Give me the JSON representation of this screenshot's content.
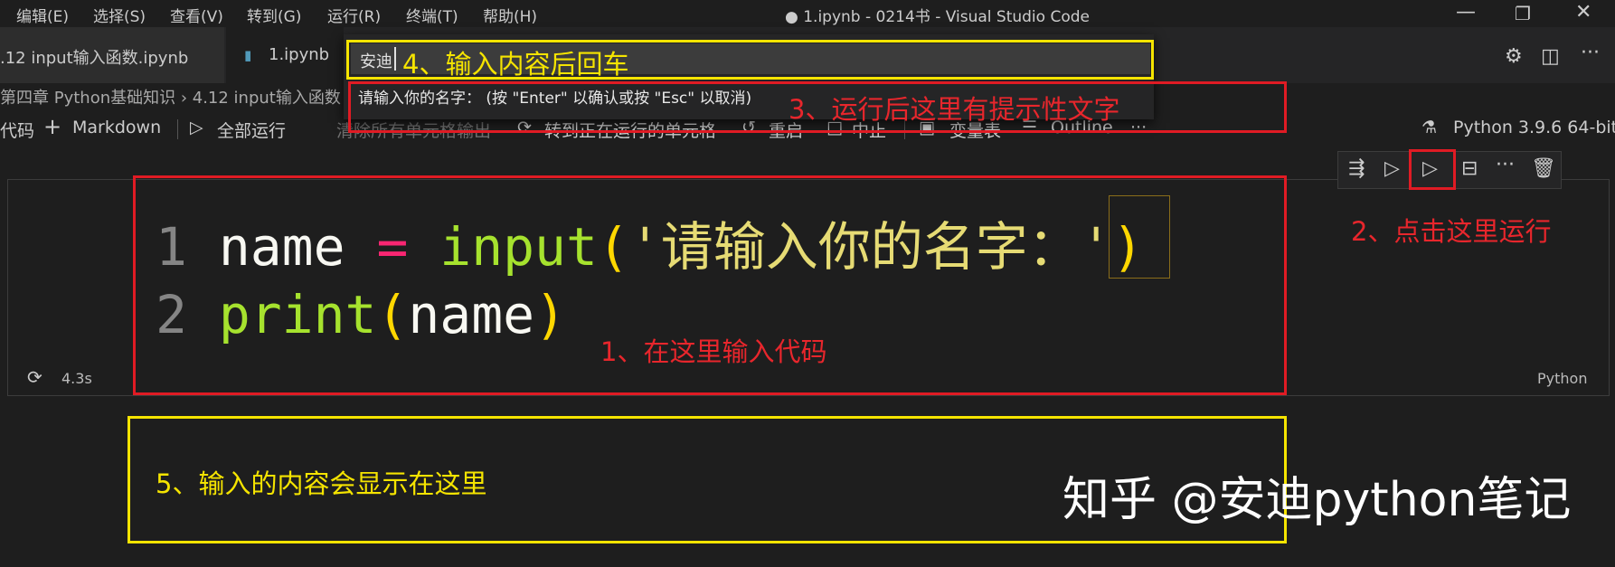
{
  "menu": [
    "编辑(E)",
    "选择(S)",
    "查看(V)",
    "转到(G)",
    "运行(R)",
    "终端(T)",
    "帮助(H)"
  ],
  "window_title": "● 1.ipynb - 0214书 - Visual Studio Code",
  "tabs": [
    {
      "label": ".12 input输入函数.ipynb"
    },
    {
      "label": "1.ipynb"
    }
  ],
  "breadcrumb": "第四章 Python基础知识 › 4.12 input输入函数",
  "toolbar": {
    "code": "代码",
    "markdown": "Markdown",
    "run_all": "全部运行",
    "clear_outputs": "清除所有单元格输出",
    "goto_running": "转到正在运行的单元格",
    "restart": "重启",
    "interrupt": "中止",
    "variables": "变量表",
    "outline": "Outline",
    "more": "···",
    "kernel": "Python 3.9.6 64-bit"
  },
  "quick_input": {
    "value": "安迪",
    "prompt": "请输入你的名字：  (按 \"Enter\" 以确认或按 \"Esc\" 以取消)"
  },
  "code": {
    "line1_no": "1",
    "line1_var": "name",
    "line1_op": "=",
    "line1_fn": "input",
    "line1_str": "'请输入你的名字：'",
    "line2_no": "2",
    "line2_fn": "print",
    "line2_arg": "name"
  },
  "cell": {
    "exec_time": "4.3s",
    "language": "Python"
  },
  "annotations": {
    "a1": "1、在这里输入代码",
    "a2": "2、点击这里运行",
    "a3": "3、运行后这里有提示性文字",
    "a4": "4、输入内容后回车",
    "a5": "5、输入的内容会显示在这里"
  },
  "watermark": "知乎 @安迪python笔记",
  "colors": {
    "annotation_red": "#e01b24",
    "annotation_yellow": "#f5e400"
  }
}
